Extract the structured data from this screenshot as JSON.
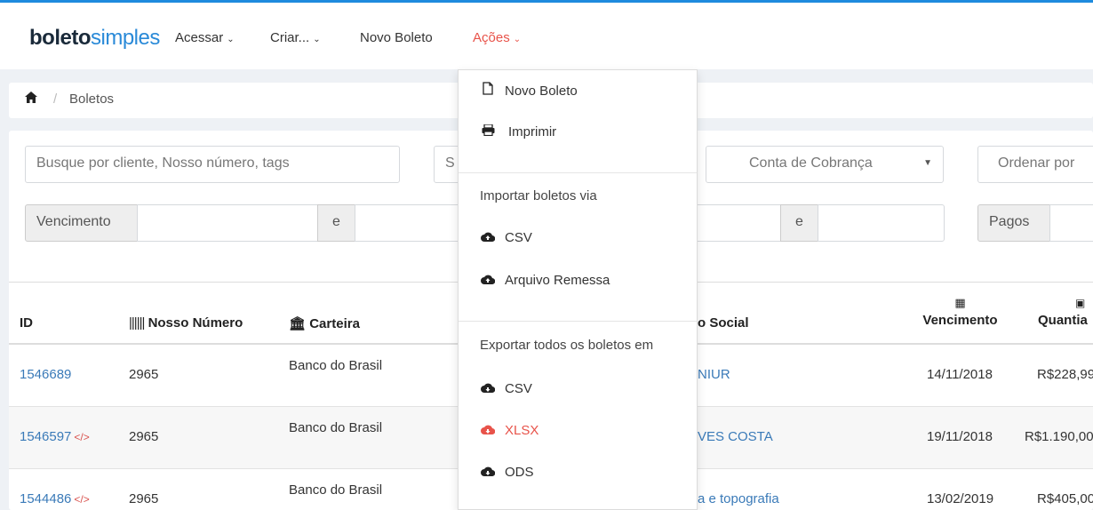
{
  "brand": {
    "logo_bold": "boleto",
    "logo_light": "simples"
  },
  "nav": {
    "acessar": "Acessar",
    "criar": "Criar...",
    "novo_boleto": "Novo Boleto",
    "acoes": "Ações",
    "caret": "⌄"
  },
  "breadcrumb": {
    "home_icon": "home-icon",
    "separator": "/",
    "current": "Boletos"
  },
  "filters": {
    "search_placeholder": "Busque por cliente, Nosso número, tags",
    "status_partial": "S",
    "conta_cobranca": "Conta de Cobrança",
    "ordenar_por": "Ordenar por",
    "vencimento_label": "Vencimento",
    "e1": "e",
    "e2": "e",
    "pagos_label": "Pagos"
  },
  "table": {
    "headers": {
      "id": "ID",
      "nosso_numero": "Nosso Número",
      "carteira": "Carteira",
      "razao_social_partial": "o Social",
      "vencimento": "Vencimento",
      "quantia_partial": "Quantia"
    },
    "rows": [
      {
        "id": "1546689",
        "code": "",
        "nosso_numero": "2965",
        "carteira": "Banco do Brasil",
        "razao": "NIUR",
        "vencimento": "14/11/2018",
        "quantia": "R$228,99"
      },
      {
        "id": "1546597",
        "code": "</>",
        "nosso_numero": "2965",
        "carteira": "Banco do Brasil",
        "razao": "VES COSTA",
        "vencimento": "19/11/2018",
        "quantia": "R$1.190,00"
      },
      {
        "id": "1544486",
        "code": "</>",
        "nosso_numero": "2965",
        "carteira": "Banco do Brasil",
        "razao": "a e topografia",
        "vencimento": "13/02/2019",
        "quantia": "R$405,00"
      }
    ]
  },
  "dropdown": {
    "novo_boleto": "Novo Boleto",
    "imprimir": "Imprimir",
    "importar_header": "Importar boletos via",
    "import_csv": "CSV",
    "import_remessa": "Arquivo Remessa",
    "exportar_header": "Exportar todos os boletos em",
    "export_csv": "CSV",
    "export_xlsx": "XLSX",
    "export_ods": "ODS"
  },
  "colors": {
    "accent": "#1e8bde",
    "active": "#e8534a",
    "link": "#3a7ab8"
  }
}
